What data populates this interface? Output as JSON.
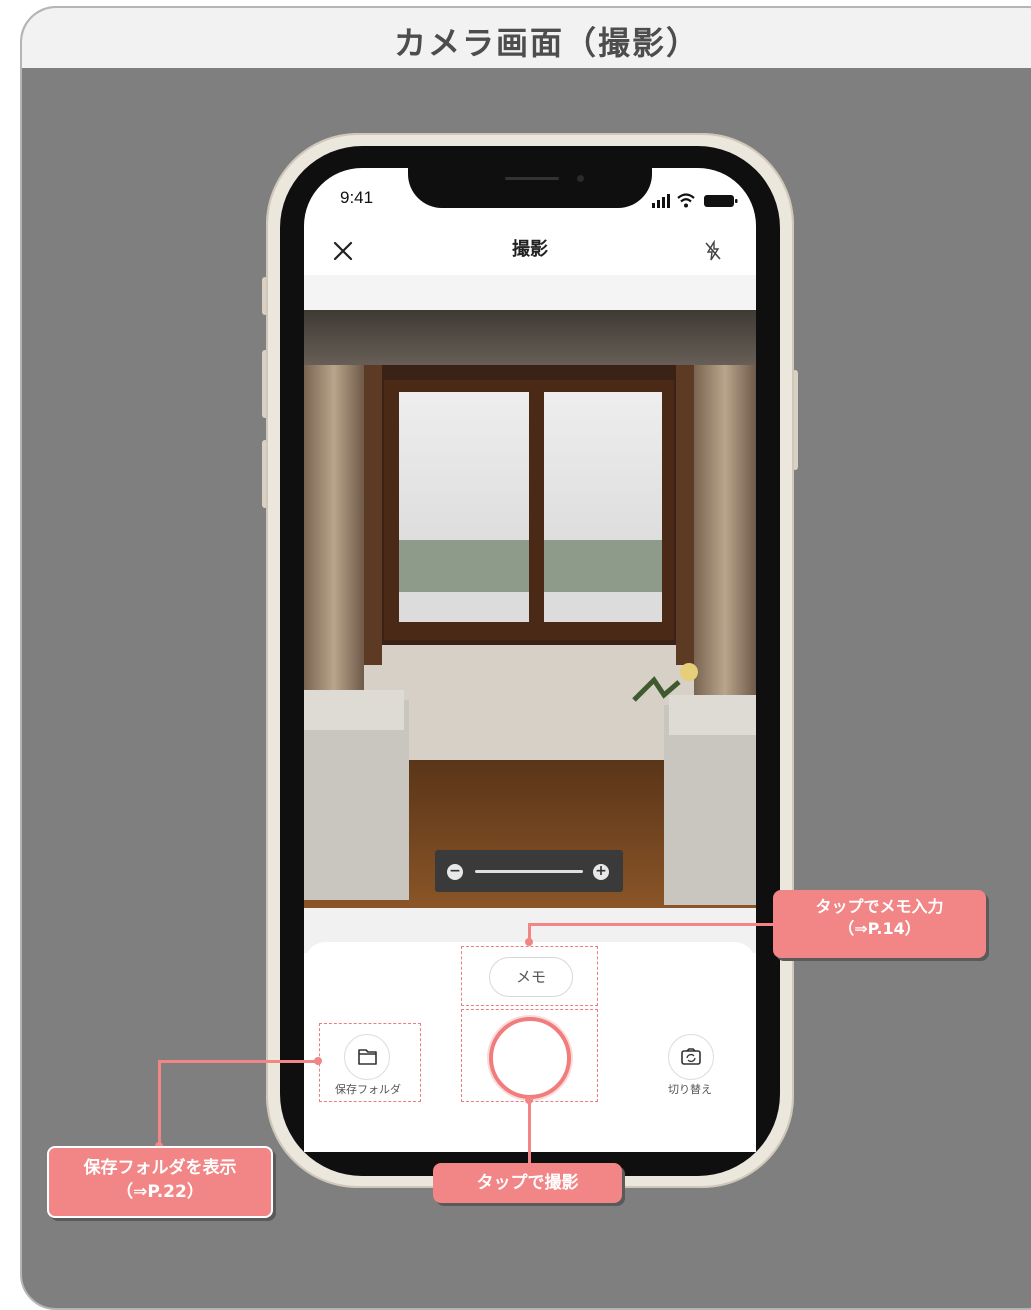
{
  "page": {
    "title": "カメラ画面（撮影）"
  },
  "status_bar": {
    "time": "9:41"
  },
  "nav": {
    "title": "撮影"
  },
  "controls": {
    "memo_label": "メモ",
    "folder_label": "保存フォルダ",
    "switch_label": "切り替え",
    "zoom_minus": "−",
    "zoom_plus": "+"
  },
  "callouts": {
    "memo": {
      "line1": "タップでメモ入力",
      "line2": "（⇒P.14）"
    },
    "shoot": {
      "line1": "タップで撮影"
    },
    "folder": {
      "line1": "保存フォルダを表示",
      "line2": "（⇒P.22）"
    }
  },
  "colors": {
    "accent": "#f28585",
    "background": "#7f7f7f",
    "header": "#f2f2f2"
  }
}
